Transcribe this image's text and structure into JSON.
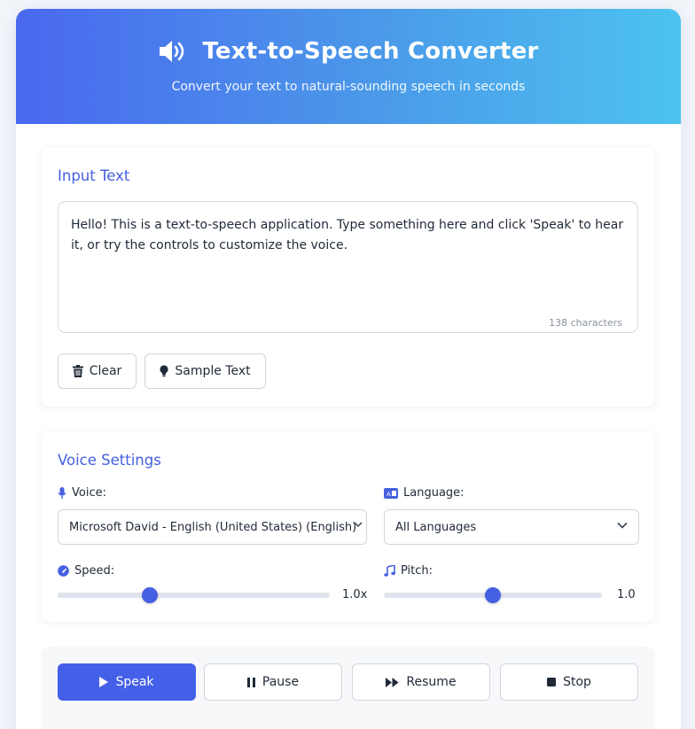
{
  "header": {
    "title": "Text-to-Speech Converter",
    "subtitle": "Convert your text to natural-sounding speech in seconds",
    "icon": "speaker-icon"
  },
  "input_section": {
    "title": "Input Text",
    "text_value": "Hello! This is a text-to-speech application. Type something here and click 'Speak' to hear it, or try the controls to customize the voice.",
    "char_count": "138 characters",
    "clear_label": "Clear",
    "clear_icon": "trash-icon",
    "sample_label": "Sample Text",
    "sample_icon": "lightbulb-icon"
  },
  "voice_settings": {
    "title": "Voice Settings",
    "voice_label": "Voice:",
    "voice_icon": "microphone-icon",
    "voice_value": "Microsoft David - English (United States) (English)",
    "language_label": "Language:",
    "language_icon": "language-icon",
    "language_value": "All Languages",
    "speed_label": "Speed:",
    "speed_icon": "gauge-icon",
    "speed_value": "1.0x",
    "speed_fraction": 0.34,
    "pitch_label": "Pitch:",
    "pitch_icon": "music-note-icon",
    "pitch_value": "1.0",
    "pitch_fraction": 0.5
  },
  "controls": {
    "speak_label": "Speak",
    "pause_label": "Pause",
    "resume_label": "Resume",
    "stop_label": "Stop"
  },
  "colors": {
    "accent": "#4560e8",
    "header_gradient_start": "#4a68ef",
    "header_gradient_end": "#4cc3ef"
  }
}
